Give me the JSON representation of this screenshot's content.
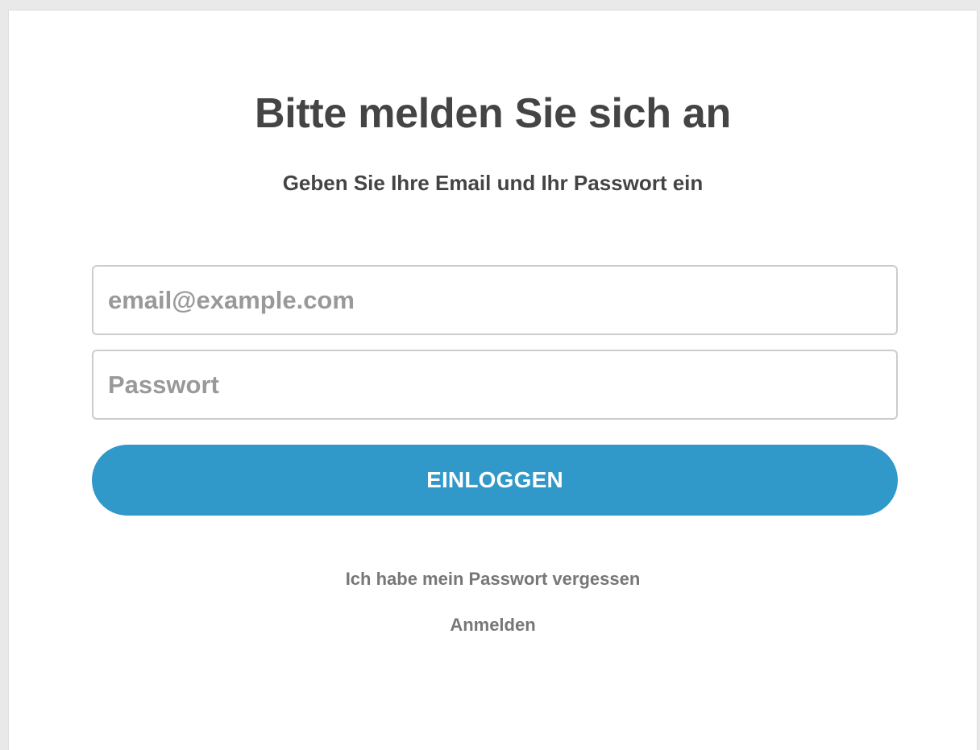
{
  "login": {
    "title": "Bitte melden Sie sich an",
    "subtitle": "Geben Sie Ihre Email und Ihr Passwort ein",
    "email_placeholder": "email@example.com",
    "password_placeholder": "Passwort",
    "submit_label": "EINLOGGEN",
    "forgot_password_link": "Ich habe mein Passwort vergessen",
    "register_link": "Anmelden"
  },
  "colors": {
    "primary_button": "#3198ca",
    "text_dark": "#444444",
    "link_text": "#777777",
    "placeholder_text": "#999999",
    "input_border": "#cccccc"
  }
}
